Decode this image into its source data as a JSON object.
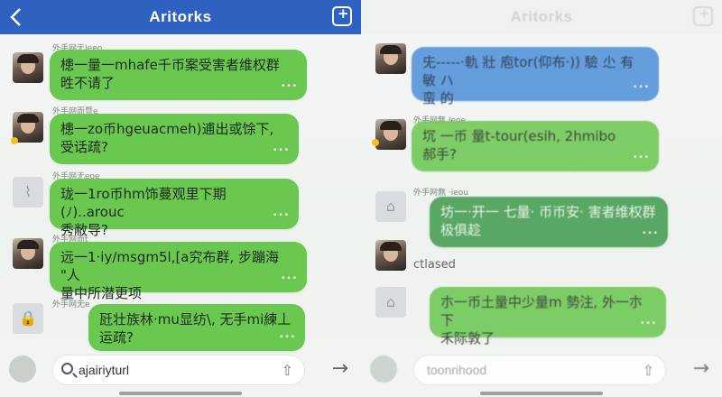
{
  "left": {
    "header": {
      "title": "Aritorks",
      "back_icon": "back-chevron-icon",
      "compose_icon": "compose-plus-icon"
    },
    "messages": [
      {
        "sender": "外手网无Ieeo",
        "text": "槵一量一mhafe千币案受害者维权群",
        "text2": "甠不请了",
        "meta": "•••"
      },
      {
        "sender": "外手网而暨e",
        "text": "槵一zo币hgeuacmeh)逋出或馀下,",
        "text2": "受话疏?",
        "meta": "•••"
      },
      {
        "sender": "外手网无eoe",
        "text": "珑一1ro币hm饰蔓观里下期(ﾉ)..arouc",
        "text2": "秀敝导?",
        "meta": "•••"
      },
      {
        "sender": "外手网而t",
        "text": "远一1·iy/msgm5l,[a究布群, 步蹦海 \"人",
        "text2": "量中所潜更项",
        "meta": "•••"
      },
      {
        "sender": "外手网无e",
        "text": "瓩壮族林·mu显纺\\, 无手mi練丄",
        "text2": "运疏?",
        "meta": "•••"
      }
    ],
    "input": {
      "value": "ajairiyturl",
      "placeholder": ""
    }
  },
  "right": {
    "header": {
      "title": "Aritorks"
    },
    "messages": [
      {
        "sender": "",
        "text": "兂-----·軌 壯 庖tor(仰布·)) 驗 尐 有 敏 ハ",
        "text2": "蛮 的",
        "meta": "•••"
      },
      {
        "sender": "外手网無 Ieoe",
        "text": "坈 一币 量t-tour(esih, 2hmibo",
        "text2": "郝手?",
        "meta": "•••"
      },
      {
        "sender": "外手网無 ·ieou",
        "text": "坊一·开一 七量· 币币安· 害者维权群",
        "text2": "极俱趁",
        "meta": "•••"
      },
      {
        "sender": "",
        "text": "朩一币土量中少量m 勢注, 外一朩下",
        "text2": "禾际敦了",
        "meta": "•••"
      }
    ],
    "link_label": "ctlased",
    "input": {
      "value": "toonrihood"
    }
  }
}
